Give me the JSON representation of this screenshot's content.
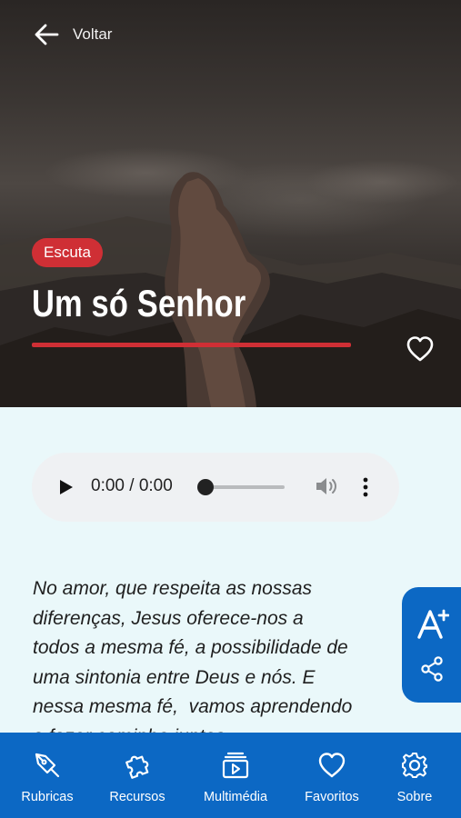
{
  "header": {
    "back_label": "Voltar",
    "tag": "Escuta",
    "title": "Um só Senhor"
  },
  "player": {
    "time": "0:00 / 0:00",
    "progress": 0
  },
  "content": {
    "text": "No amor, que respeita as nossas\ndiferenças, Jesus oferece-nos a\ntodos a mesma fé, a possibilidade de\numa sintonia entre Deus e nós. E\nnessa mesma fé,  vamos aprendendo\na fazer caminho juntos."
  },
  "colors": {
    "accent_red": "#cf2f35",
    "primary_blue": "#0c68c4",
    "background": "#eaf8fa"
  },
  "bottom_nav": {
    "items": [
      {
        "label": "Rubricas",
        "icon": "pen-nib-icon"
      },
      {
        "label": "Recursos",
        "icon": "puzzle-icon"
      },
      {
        "label": "Multimédia",
        "icon": "media-stack-icon"
      },
      {
        "label": "Favoritos",
        "icon": "heart-icon"
      },
      {
        "label": "Sobre",
        "icon": "gear-icon"
      }
    ]
  }
}
